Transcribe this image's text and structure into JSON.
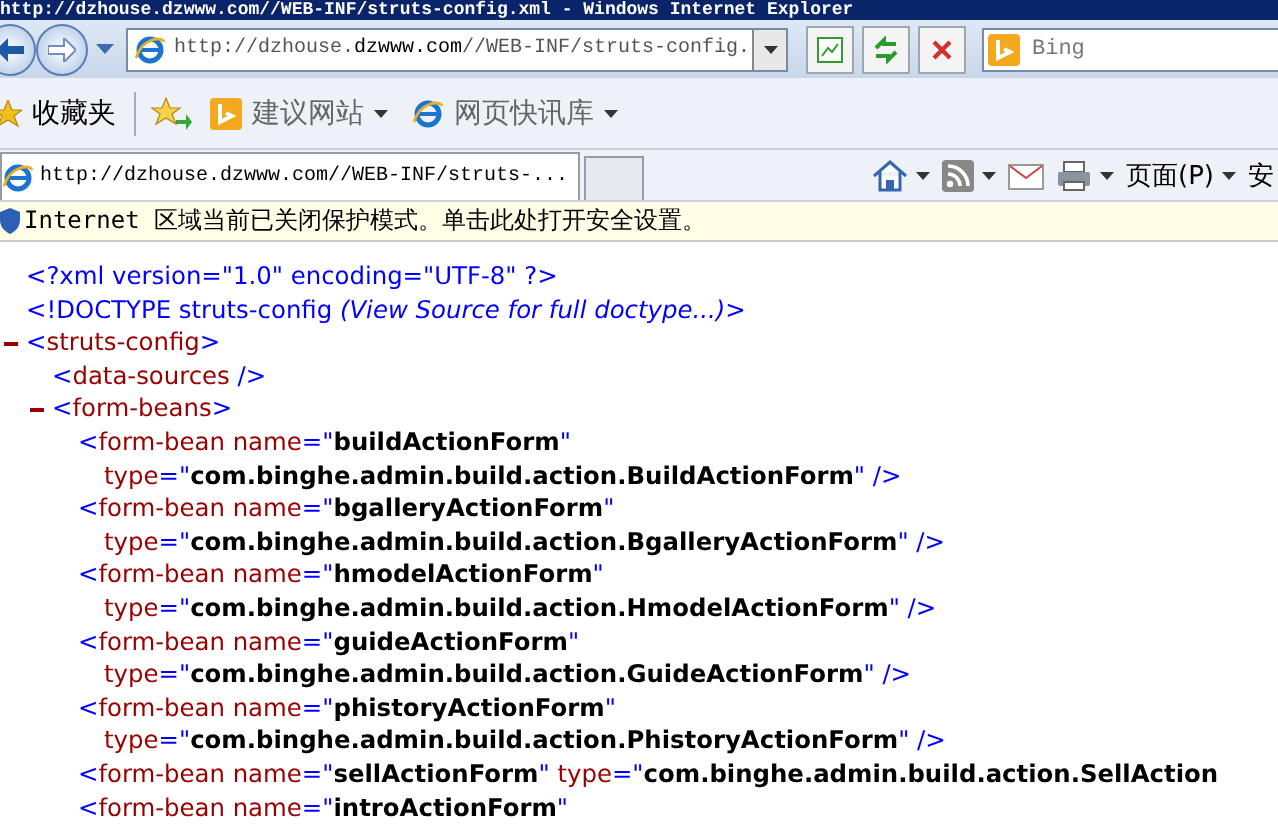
{
  "window": {
    "title": "http://dzhouse.dzwww.com//WEB-INF/struts-config.xml - Windows Internet Explorer"
  },
  "address_bar": {
    "value": "http://dzhouse.**dzwww.com**//WEB-INF/struts-config."
  },
  "search": {
    "placeholder": "Bing"
  },
  "favorites_bar": {
    "label": "收藏夹",
    "items": [
      {
        "label": "建议网站",
        "kind": "bing"
      },
      {
        "label": "网页快讯库",
        "kind": "ie"
      }
    ]
  },
  "tabs": [
    {
      "label": "http://dzhouse.dzwww.com//WEB-INF/struts-...",
      "selected": true
    }
  ],
  "command_bar": {
    "page_menu": "页面(P)",
    "safety_menu": "安"
  },
  "info_bar": {
    "text": "Internet 区域当前已关闭保护模式。单击此处打开安全设置。"
  },
  "document": {
    "prolog": [
      [
        {
          "kind": "markup",
          "text": "<?xml version=\"1.0\" encoding=\"UTF-8\" ?>"
        }
      ],
      [
        {
          "kind": "markup",
          "text": "<!DOCTYPE struts-config "
        },
        {
          "kind": "note",
          "text": "(View Source for full doctype...)"
        },
        {
          "kind": "markup",
          "text": ">"
        }
      ]
    ],
    "tree": [
      {
        "expanded": true,
        "lines": [
          [
            {
              "kind": "markup",
              "text": "<"
            },
            {
              "kind": "name",
              "text": "struts-config"
            },
            {
              "kind": "markup",
              "text": ">"
            }
          ]
        ],
        "children": [
          {
            "lines": [
              [
                {
                  "kind": "markup",
                  "text": "<"
                },
                {
                  "kind": "name",
                  "text": "data-sources"
                },
                {
                  "kind": "markup",
                  "text": " />"
                }
              ]
            ]
          },
          {
            "expanded": true,
            "lines": [
              [
                {
                  "kind": "markup",
                  "text": "<"
                },
                {
                  "kind": "name",
                  "text": "form-beans"
                },
                {
                  "kind": "markup",
                  "text": ">"
                }
              ]
            ],
            "children": [
              {
                "lines": [
                  [
                    {
                      "kind": "markup",
                      "text": "<"
                    },
                    {
                      "kind": "name",
                      "text": "form-bean name"
                    },
                    {
                      "kind": "markup",
                      "text": "=\""
                    },
                    {
                      "kind": "value",
                      "text": "buildActionForm"
                    },
                    {
                      "kind": "markup",
                      "text": "\""
                    }
                  ],
                  [
                    {
                      "kind": "name",
                      "text": "type"
                    },
                    {
                      "kind": "markup",
                      "text": "=\""
                    },
                    {
                      "kind": "value",
                      "text": "com.binghe.admin.build.action.BuildActionForm"
                    },
                    {
                      "kind": "markup",
                      "text": "\" />"
                    }
                  ]
                ]
              },
              {
                "lines": [
                  [
                    {
                      "kind": "markup",
                      "text": "<"
                    },
                    {
                      "kind": "name",
                      "text": "form-bean name"
                    },
                    {
                      "kind": "markup",
                      "text": "=\""
                    },
                    {
                      "kind": "value",
                      "text": "bgalleryActionForm"
                    },
                    {
                      "kind": "markup",
                      "text": "\""
                    }
                  ],
                  [
                    {
                      "kind": "name",
                      "text": "type"
                    },
                    {
                      "kind": "markup",
                      "text": "=\""
                    },
                    {
                      "kind": "value",
                      "text": "com.binghe.admin.build.action.BgalleryActionForm"
                    },
                    {
                      "kind": "markup",
                      "text": "\" />"
                    }
                  ]
                ]
              },
              {
                "lines": [
                  [
                    {
                      "kind": "markup",
                      "text": "<"
                    },
                    {
                      "kind": "name",
                      "text": "form-bean name"
                    },
                    {
                      "kind": "markup",
                      "text": "=\""
                    },
                    {
                      "kind": "value",
                      "text": "hmodelActionForm"
                    },
                    {
                      "kind": "markup",
                      "text": "\""
                    }
                  ],
                  [
                    {
                      "kind": "name",
                      "text": "type"
                    },
                    {
                      "kind": "markup",
                      "text": "=\""
                    },
                    {
                      "kind": "value",
                      "text": "com.binghe.admin.build.action.HmodelActionForm"
                    },
                    {
                      "kind": "markup",
                      "text": "\" />"
                    }
                  ]
                ]
              },
              {
                "lines": [
                  [
                    {
                      "kind": "markup",
                      "text": "<"
                    },
                    {
                      "kind": "name",
                      "text": "form-bean name"
                    },
                    {
                      "kind": "markup",
                      "text": "=\""
                    },
                    {
                      "kind": "value",
                      "text": "guideActionForm"
                    },
                    {
                      "kind": "markup",
                      "text": "\""
                    }
                  ],
                  [
                    {
                      "kind": "name",
                      "text": "type"
                    },
                    {
                      "kind": "markup",
                      "text": "=\""
                    },
                    {
                      "kind": "value",
                      "text": "com.binghe.admin.build.action.GuideActionForm"
                    },
                    {
                      "kind": "markup",
                      "text": "\" />"
                    }
                  ]
                ]
              },
              {
                "lines": [
                  [
                    {
                      "kind": "markup",
                      "text": "<"
                    },
                    {
                      "kind": "name",
                      "text": "form-bean name"
                    },
                    {
                      "kind": "markup",
                      "text": "=\""
                    },
                    {
                      "kind": "value",
                      "text": "phistoryActionForm"
                    },
                    {
                      "kind": "markup",
                      "text": "\""
                    }
                  ],
                  [
                    {
                      "kind": "name",
                      "text": "type"
                    },
                    {
                      "kind": "markup",
                      "text": "=\""
                    },
                    {
                      "kind": "value",
                      "text": "com.binghe.admin.build.action.PhistoryActionForm"
                    },
                    {
                      "kind": "markup",
                      "text": "\" />"
                    }
                  ]
                ]
              },
              {
                "lines": [
                  [
                    {
                      "kind": "markup",
                      "text": "<"
                    },
                    {
                      "kind": "name",
                      "text": "form-bean name"
                    },
                    {
                      "kind": "markup",
                      "text": "=\""
                    },
                    {
                      "kind": "value",
                      "text": "sellActionForm"
                    },
                    {
                      "kind": "markup",
                      "text": "\" "
                    },
                    {
                      "kind": "name",
                      "text": "type"
                    },
                    {
                      "kind": "markup",
                      "text": "=\""
                    },
                    {
                      "kind": "value",
                      "text": "com.binghe.admin.build.action.SellAction"
                    }
                  ]
                ]
              },
              {
                "lines": [
                  [
                    {
                      "kind": "markup",
                      "text": "<"
                    },
                    {
                      "kind": "name",
                      "text": "form-bean name"
                    },
                    {
                      "kind": "markup",
                      "text": "=\""
                    },
                    {
                      "kind": "value",
                      "text": "introActionForm"
                    },
                    {
                      "kind": "markup",
                      "text": "\""
                    }
                  ]
                ]
              }
            ]
          }
        ]
      }
    ]
  }
}
